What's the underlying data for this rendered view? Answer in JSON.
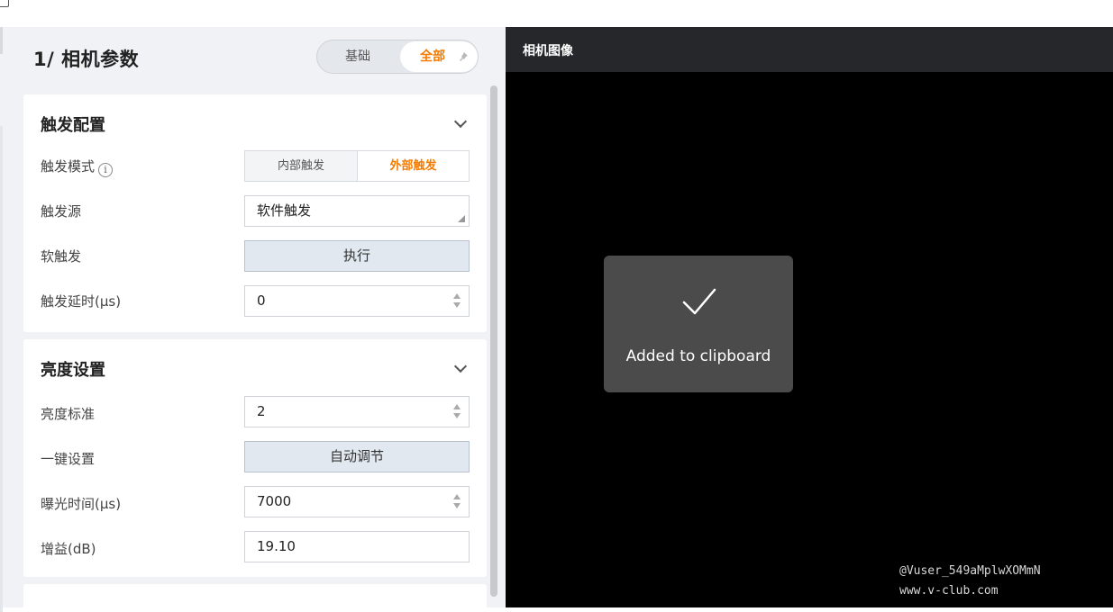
{
  "panel": {
    "title": "1/ 相机参数",
    "mode_toggle": {
      "basic_label": "基础",
      "all_label": "全部",
      "active": "全部"
    }
  },
  "trigger_section": {
    "title": "触发配置",
    "trigger_mode": {
      "label": "触发模式",
      "options": [
        "内部触发",
        "外部触发"
      ],
      "selected": "外部触发"
    },
    "trigger_source": {
      "label": "触发源",
      "value": "软件触发"
    },
    "soft_trigger": {
      "label": "软触发",
      "button_label": "执行"
    },
    "trigger_delay": {
      "label": "触发延时(µs)",
      "value": "0"
    }
  },
  "brightness_section": {
    "title": "亮度设置",
    "brightness_standard": {
      "label": "亮度标准",
      "value": "2"
    },
    "one_key": {
      "label": "一键设置",
      "button_label": "自动调节"
    },
    "exposure": {
      "label": "曝光时间(µs)",
      "value": "7000"
    },
    "gain": {
      "label": "增益(dB)",
      "value": "19.10"
    }
  },
  "camera": {
    "title": "相机图像"
  },
  "toast": {
    "message": "Added to clipboard"
  },
  "watermark": {
    "line1": "@Vuser_549aMplwXOMmN",
    "line2": "www.v-club.com"
  },
  "colors": {
    "accent": "#f47b00",
    "panel_bg": "#f0f2f5",
    "camera_header": "#26272b",
    "toast_bg": "#4b4b4b"
  },
  "icons": [
    "info-icon",
    "pin-icon",
    "chevron-down-icon",
    "check-icon",
    "select-arrow-icon",
    "spinner-icon"
  ]
}
